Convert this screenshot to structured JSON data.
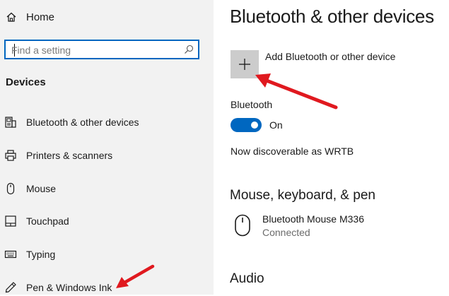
{
  "sidebar": {
    "home_label": "Home",
    "search_placeholder": "Find a setting",
    "section_title": "Devices",
    "items": [
      {
        "label": "Bluetooth & other devices",
        "icon": "bluetooth-devices-icon"
      },
      {
        "label": "Printers & scanners",
        "icon": "printer-icon"
      },
      {
        "label": "Mouse",
        "icon": "mouse-icon"
      },
      {
        "label": "Touchpad",
        "icon": "touchpad-icon"
      },
      {
        "label": "Typing",
        "icon": "keyboard-icon"
      },
      {
        "label": "Pen & Windows Ink",
        "icon": "pen-icon"
      }
    ]
  },
  "main": {
    "title": "Bluetooth & other devices",
    "add_device_label": "Add Bluetooth or other device",
    "bluetooth_label": "Bluetooth",
    "bluetooth_state": "On",
    "bluetooth_on": true,
    "discoverable_text": "Now discoverable as",
    "device_name": "WRTB",
    "mouse_section_title": "Mouse, keyboard, & pen",
    "devices": [
      {
        "name": "Bluetooth Mouse M336",
        "status": "Connected",
        "icon": "mouse-icon"
      }
    ],
    "audio_section_title": "Audio"
  },
  "colors": {
    "accent": "#0067c0",
    "annotation_arrow": "#e0191f",
    "sidebar_bg": "#f2f2f2",
    "add_button_bg": "#cccccc"
  }
}
